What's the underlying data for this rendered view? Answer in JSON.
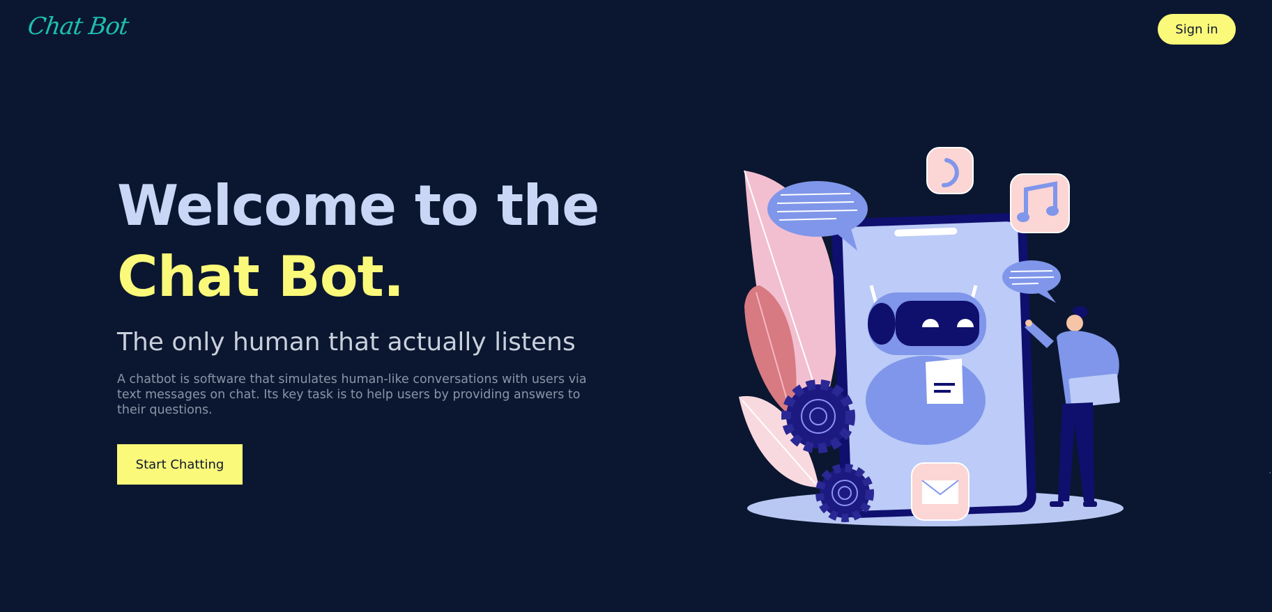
{
  "header": {
    "logo_text": "Chat Bot",
    "signin_label": "Sign in"
  },
  "hero": {
    "title_line1": "Welcome to the",
    "title_line2": "Chat Bot.",
    "subtitle": "The only human that actually listens",
    "description": "A chatbot is software that simulates human-like conversations with users via text messages on chat. Its key task is to help users by providing answers to their questions.",
    "cta_label": "Start Chatting"
  },
  "illustration": {
    "icons": [
      "phone-icon",
      "music-note-icon",
      "mail-icon",
      "gear-icon",
      "robot-icon",
      "chat-bubble-icon"
    ]
  },
  "colors": {
    "background": "#0b1730",
    "accent_yellow": "#fbf97a",
    "logo_teal": "#1fbfb0",
    "title_lavender": "#c9d6f6",
    "illustration_blue": "#7f96ea",
    "illustration_navy": "#0f0f6e",
    "illustration_pink": "#fcd5d5"
  }
}
